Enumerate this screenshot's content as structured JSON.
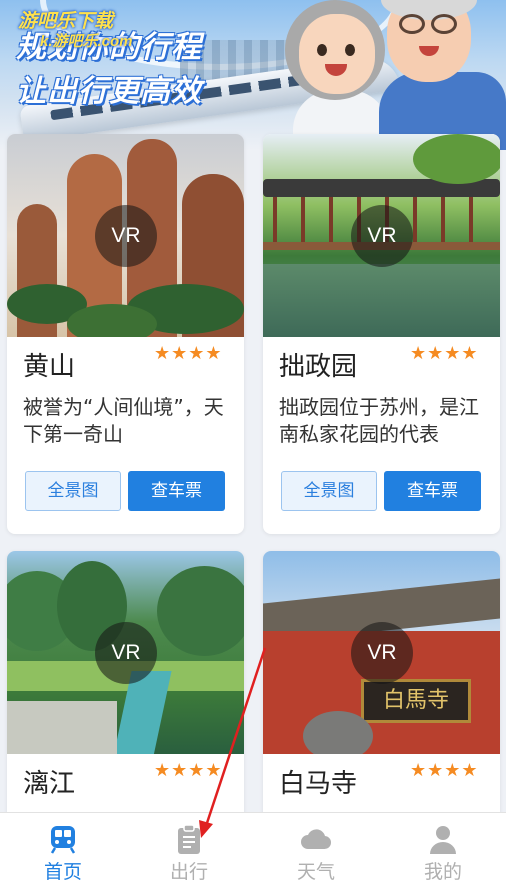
{
  "banner": {
    "overlay_line1": "游吧乐下载",
    "overlay_line2": "k.游吧乐.com",
    "title_line1": "规划你的行程",
    "title_line2": "让出行更高效"
  },
  "attractions": [
    {
      "name": "黄山",
      "rating": "★★★★",
      "vr_label": "VR",
      "description": "被誉为“人间仙境”，天下第一奇山",
      "panorama_label": "全景图",
      "ticket_label": "查车票"
    },
    {
      "name": "拙政园",
      "rating": "★★★★",
      "vr_label": "VR",
      "description": "拙政园位于苏州，是江南私家花园的代表",
      "panorama_label": "全景图",
      "ticket_label": "查车票"
    },
    {
      "name": "漓江",
      "rating": "★★★★",
      "vr_label": "VR"
    },
    {
      "name": "白马寺",
      "rating": "★★★★",
      "vr_label": "VR",
      "plaque_text": "白馬寺"
    }
  ],
  "bottom_nav": [
    {
      "label": "首页",
      "icon": "train-icon",
      "active": true
    },
    {
      "label": "出行",
      "icon": "clipboard-icon",
      "active": false
    },
    {
      "label": "天气",
      "icon": "cloud-icon",
      "active": false
    },
    {
      "label": "我的",
      "icon": "user-icon",
      "active": false
    }
  ],
  "colors": {
    "accent": "#2180e0",
    "star": "#f58b22",
    "inactive_nav": "#b0b0b0",
    "annotation_arrow": "#e02020"
  }
}
